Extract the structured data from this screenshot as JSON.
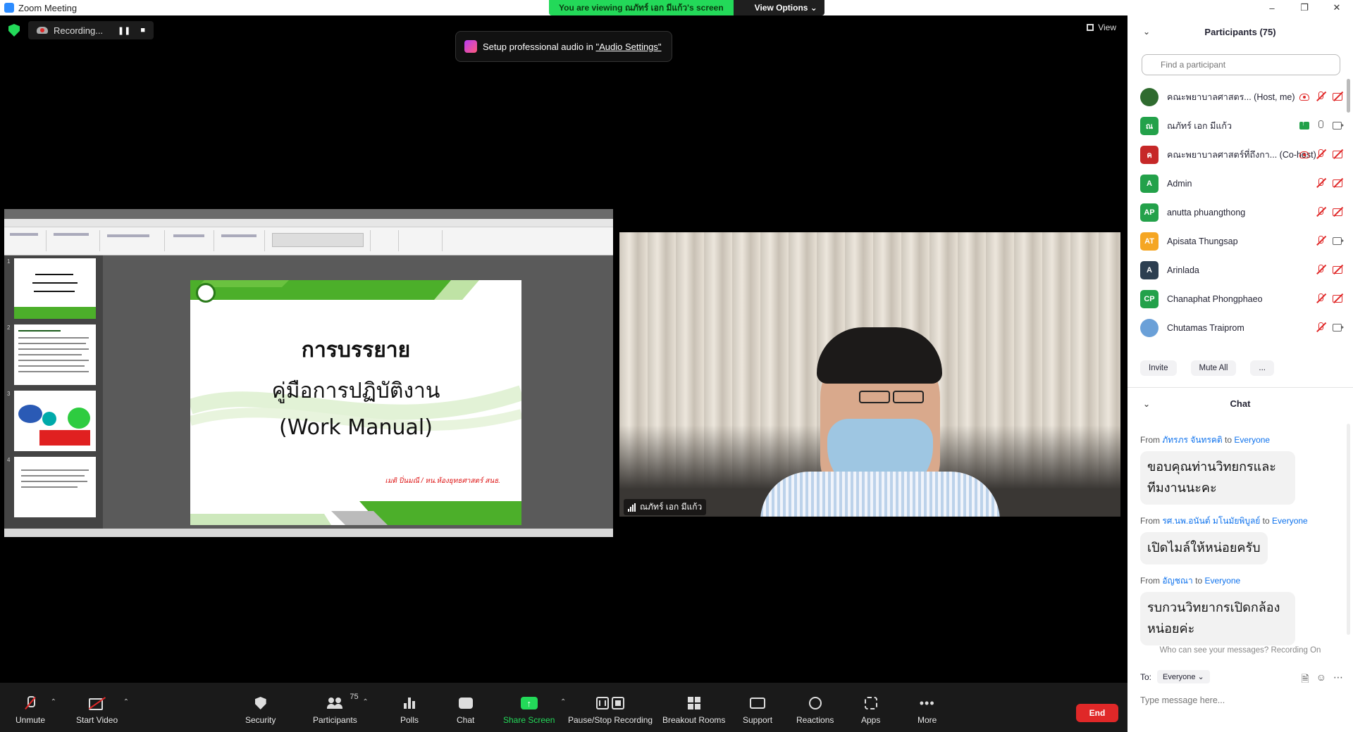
{
  "window": {
    "title": "Zoom Meeting",
    "minimize": "–",
    "restore": "❐",
    "close": "✕"
  },
  "banner": {
    "viewing_prefix": "You are viewing ",
    "viewing_name": "ณภัทร์ เอก มีแก้ว",
    "viewing_suffix": "'s screen",
    "view_options": "View Options ⌄"
  },
  "recording": {
    "label": "Recording...",
    "pause": "❚❚",
    "stop": "■"
  },
  "view_button": {
    "label": "View"
  },
  "audio_toast": {
    "text": "Setup professional audio in ",
    "link": "\"Audio Settings\""
  },
  "slide": {
    "title_line1": "การบรรยาย",
    "title_line2": "คู่มือการปฏิบัติงาน",
    "title_line3": "(Work Manual)",
    "author": "เมติ ปิ่นมณี / หน.ห้องยุทธศาสตร์ สนธ."
  },
  "video": {
    "name": "ณภัทร์ เอก มีแก้ว"
  },
  "participants": {
    "title": "Participants (75)",
    "search_placeholder": "Find a participant",
    "items": [
      {
        "initials": "",
        "name": "คณะพยาบาลศาสตร... (Host, me)",
        "color": "#2f6b2f",
        "mic": "off",
        "cam": "off",
        "recording": true,
        "sharing": false
      },
      {
        "initials": "ณ",
        "name": "ณภัทร์ เอก มีแก้ว",
        "color": "#23a14a",
        "mic": "on",
        "cam": "on",
        "recording": false,
        "sharing": true
      },
      {
        "initials": "ค",
        "name": "คณะพยาบาลศาสตร์ที่ถึงกา... (Co-host)",
        "color": "#c62828",
        "mic": "off",
        "cam": "off",
        "recording": true,
        "sharing": false
      },
      {
        "initials": "A",
        "name": "Admin",
        "color": "#23a14a",
        "mic": "off",
        "cam": "off",
        "recording": false,
        "sharing": false
      },
      {
        "initials": "AP",
        "name": "anutta phuangthong",
        "color": "#23a14a",
        "mic": "off",
        "cam": "off",
        "recording": false,
        "sharing": false
      },
      {
        "initials": "AT",
        "name": "Apisata Thungsap",
        "color": "#f5a623",
        "mic": "off",
        "cam": "on",
        "recording": false,
        "sharing": false
      },
      {
        "initials": "A",
        "name": "Arinlada",
        "color": "#2c3e50",
        "mic": "off",
        "cam": "off",
        "recording": false,
        "sharing": false
      },
      {
        "initials": "CP",
        "name": "Chanaphat Phongphaeo",
        "color": "#23a14a",
        "mic": "off",
        "cam": "off",
        "recording": false,
        "sharing": false
      },
      {
        "initials": "",
        "name": "Chutamas Traiprom",
        "color": "#6aa0d8",
        "mic": "off",
        "cam": "on",
        "recording": false,
        "sharing": false
      }
    ],
    "invite": "Invite",
    "mute_all": "Mute All",
    "more": "..."
  },
  "chat": {
    "title": "Chat",
    "messages": [
      {
        "from": "ภัทรภร จันทรคติ",
        "to": "Everyone",
        "text": "ขอบคุณท่านวิทยกรและทีมงานนะคะ"
      },
      {
        "from": "รศ.นพ.อนันต์ มโนมัยพิบูลย์",
        "to": "Everyone",
        "text": "เปิดไมล์ให้หน่อยครับ"
      },
      {
        "from": "อัญชณา",
        "to": "Everyone",
        "text": "รบกวนวิทยากรเปิดกล้องหน่อยค่ะ"
      }
    ],
    "from_word": "From ",
    "to_word": " to ",
    "notice": "Who can see your messages? Recording On",
    "to_label": "To:",
    "to_value": "Everyone ⌄",
    "file_icon": "🗎",
    "emoji_icon": "☺",
    "more_icon": "⋯",
    "input_placeholder": "Type message here..."
  },
  "toolbar": {
    "unmute": "Unmute",
    "start_video": "Start Video",
    "security": "Security",
    "participants": "Participants",
    "participants_count": "75",
    "polls": "Polls",
    "chat": "Chat",
    "share_screen": "Share Screen",
    "pause_stop_recording": "Pause/Stop Recording",
    "breakout_rooms": "Breakout Rooms",
    "support": "Support",
    "reactions": "Reactions",
    "apps": "Apps",
    "more": "More",
    "end": "End"
  },
  "colors": {
    "zoom_blue": "#0e72ed",
    "share_green": "#23d959",
    "end_red": "#e02828",
    "slide_green": "#4caf2a"
  }
}
